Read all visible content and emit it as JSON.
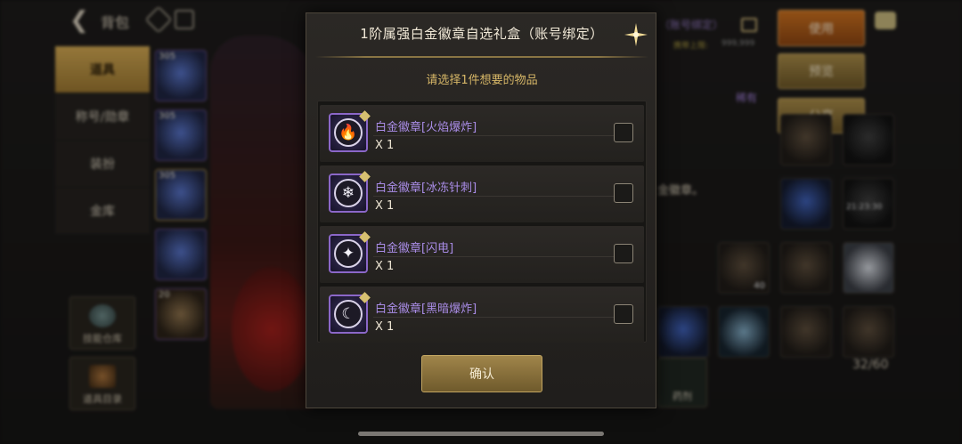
{
  "background": {
    "header": {
      "title": "背包"
    },
    "left_tabs": [
      "道具",
      "称号/勋章",
      "装扮",
      "金库"
    ],
    "side_buttons": [
      "技能仓库",
      "道具目录"
    ],
    "item_counts": [
      "305",
      "305",
      "305",
      "",
      "20"
    ],
    "right_panel": {
      "binding_label": "（账号绑定）",
      "holding_limit_label": "携带上限:",
      "holding_limit_value": "999,999",
      "rarity": "稀有",
      "description": "金徽章。"
    },
    "actions": {
      "use": "使用",
      "preview": "预览",
      "share": "分享"
    },
    "timer": "21:23:30",
    "stack_count": "40",
    "potion_label": "药剂",
    "capacity": "32/60"
  },
  "modal": {
    "title": "1阶属强白金徽章自选礼盒（账号绑定）",
    "subtitle": "请选择1件想要的物品",
    "options": [
      {
        "name": "白金徽章[火焰爆炸]",
        "qty": "X 1",
        "icon": "fire-icon",
        "glyph": "🔥"
      },
      {
        "name": "白金徽章[冰冻针刺]",
        "qty": "X 1",
        "icon": "snowflake-icon",
        "glyph": "❄"
      },
      {
        "name": "白金徽章[闪电]",
        "qty": "X 1",
        "icon": "light-star-icon",
        "glyph": "✦"
      },
      {
        "name": "白金徽章[黑暗爆炸]",
        "qty": "X 1",
        "icon": "crescent-moon-icon",
        "glyph": "☾"
      }
    ],
    "confirm_label": "确认"
  },
  "colors": {
    "accent_gold": "#c2a561",
    "item_purple": "#a98ce6",
    "use_orange": "#c9701f"
  }
}
